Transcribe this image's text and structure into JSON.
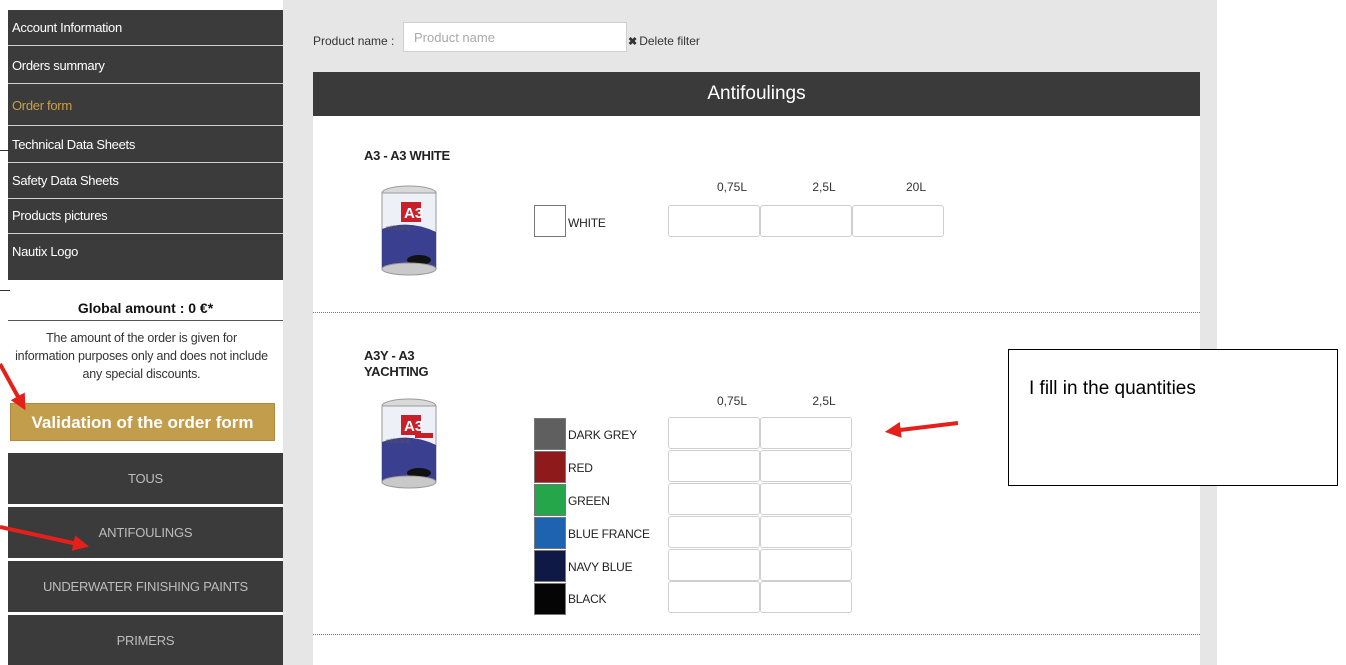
{
  "sidebar": {
    "menu": [
      {
        "label": "Account Information",
        "active": false
      },
      {
        "label": "Orders summary",
        "active": false
      },
      {
        "label": "Order form",
        "active": true
      },
      {
        "label": "Technical Data Sheets",
        "active": false
      },
      {
        "label": "Safety Data Sheets",
        "active": false
      },
      {
        "label": "Products pictures",
        "active": false
      },
      {
        "label": "Nautix Logo",
        "active": false
      }
    ],
    "amount_title": "Global amount : 0 €*",
    "amount_note_lines": [
      "The amount of the order is given for",
      "information purposes only and does not include",
      "any special discounts."
    ],
    "validate_label": "Validation of the order form",
    "categories": [
      "TOUS",
      "ANTIFOULINGS",
      "UNDERWATER FINISHING PAINTS",
      "PRIMERS"
    ]
  },
  "filter": {
    "label": "Product name :",
    "placeholder": "Product name",
    "value": "",
    "delete_label": "Delete filter"
  },
  "section": {
    "title": "Antifoulings"
  },
  "products": [
    {
      "title_lines": [
        "A3 - A3 WHITE"
      ],
      "sizes": [
        "0,75L",
        "2,5L",
        "20L"
      ],
      "colors": [
        {
          "name": "WHITE",
          "hex": "#ffffff"
        }
      ]
    },
    {
      "title_lines": [
        "A3Y - A3",
        "YACHTING"
      ],
      "sizes": [
        "0,75L",
        "2,5L"
      ],
      "colors": [
        {
          "name": "DARK GREY",
          "hex": "#5f5f5f"
        },
        {
          "name": "RED",
          "hex": "#8e1a1c"
        },
        {
          "name": "GREEN",
          "hex": "#26a64a"
        },
        {
          "name": "BLUE FRANCE",
          "hex": "#1e63b0"
        },
        {
          "name": "NAVY BLUE",
          "hex": "#0e1a45"
        },
        {
          "name": "BLACK",
          "hex": "#050505"
        }
      ]
    }
  ],
  "annotation": {
    "text": "I fill in the quantities"
  },
  "colors": {
    "accent_gold": "#c29d4c",
    "dark_menu": "#3b3b3b",
    "arrow_red": "#e5201b"
  }
}
